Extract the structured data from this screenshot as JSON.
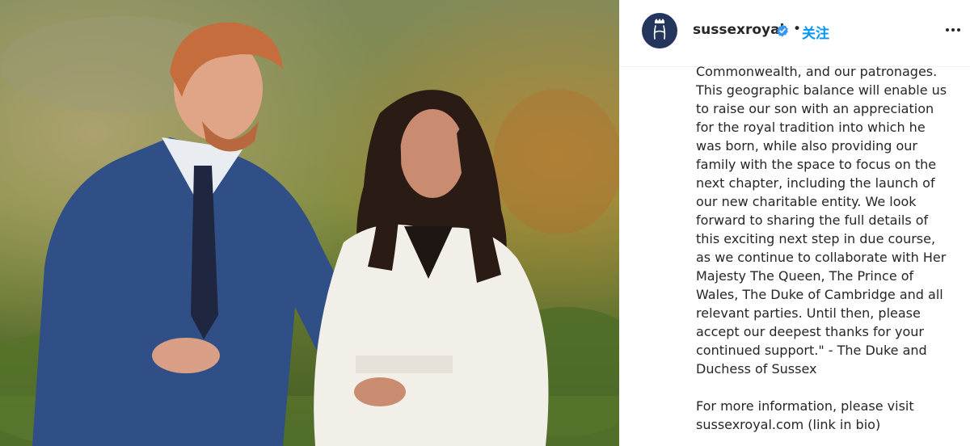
{
  "header": {
    "username": "sussexroyal",
    "separator": "•",
    "follow_label": "关注"
  },
  "icons": {
    "avatar": "monogram-h-avatar",
    "verified": "verified-badge-icon",
    "more": "more-options-icon"
  },
  "colors": {
    "follow": "#0095f6",
    "avatar_bg": "#24365d",
    "text": "#262626"
  },
  "caption": {
    "paragraph1": "Commonwealth, and our patronages.\nThis geographic balance will enable us\nto raise our son with an appreciation\nfor the royal tradition into which he\nwas born, while also providing our\nfamily with the space to focus on the\nnext chapter, including the launch of\nour new charitable entity. We look\nforward to sharing the full details of\nthis exciting next step in due course,\nas we continue to collaborate with Her\nMajesty The Queen, The Prince of\nWales, The Duke of Cambridge and all\nrelevant parties. Until then, please\naccept our deepest thanks for your\ncontinued support.\" - The Duke and\nDuchess of Sussex",
    "paragraph2": "For more information, please visit\nsussexroyal.com (link in bio)"
  }
}
